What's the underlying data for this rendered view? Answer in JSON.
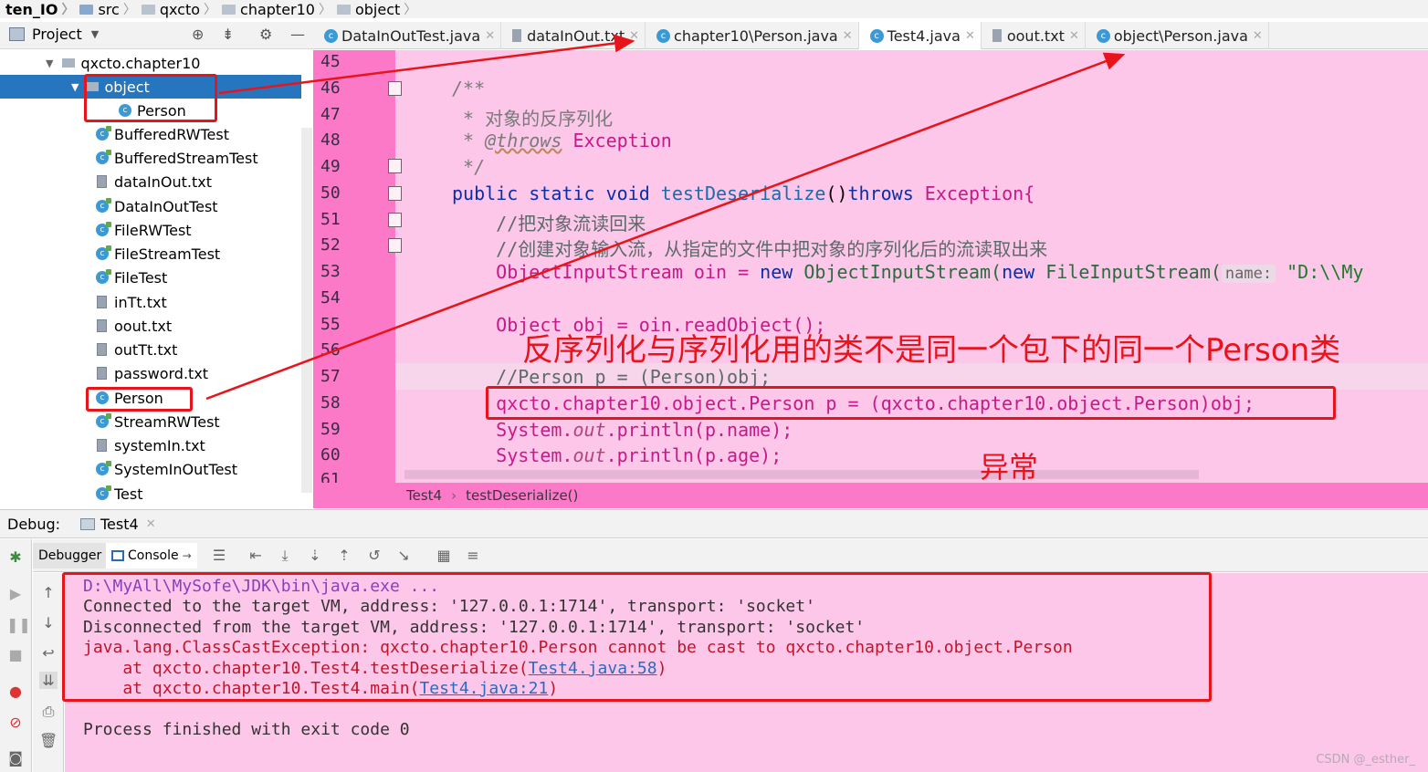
{
  "breadcrumb": [
    "ten_IO",
    "src",
    "qxcto",
    "chapter10",
    "object"
  ],
  "project_panel": {
    "title": "Project"
  },
  "tree": {
    "root": "qxcto.chapter10",
    "items": [
      {
        "label": "object",
        "kind": "package"
      },
      {
        "label": "Person",
        "kind": "class"
      },
      {
        "label": "BufferedRWTest",
        "kind": "runclass"
      },
      {
        "label": "BufferedStreamTest",
        "kind": "runclass"
      },
      {
        "label": "dataInOut.txt",
        "kind": "file"
      },
      {
        "label": "DataInOutTest",
        "kind": "runclass"
      },
      {
        "label": "FileRWTest",
        "kind": "runclass"
      },
      {
        "label": "FileStreamTest",
        "kind": "runclass"
      },
      {
        "label": "FileTest",
        "kind": "runclass"
      },
      {
        "label": "inTt.txt",
        "kind": "file"
      },
      {
        "label": "oout.txt",
        "kind": "file"
      },
      {
        "label": "outTt.txt",
        "kind": "file"
      },
      {
        "label": "password.txt",
        "kind": "file"
      },
      {
        "label": "Person",
        "kind": "class"
      },
      {
        "label": "StreamRWTest",
        "kind": "runclass"
      },
      {
        "label": "systemIn.txt",
        "kind": "file"
      },
      {
        "label": "SystemInOutTest",
        "kind": "runclass"
      },
      {
        "label": "Test",
        "kind": "runclass"
      }
    ]
  },
  "tabs": [
    {
      "label": "DataInOutTest.java",
      "icon": "class"
    },
    {
      "label": "dataInOut.txt",
      "icon": "file"
    },
    {
      "label": "chapter10\\Person.java",
      "icon": "class"
    },
    {
      "label": "Test4.java",
      "icon": "class",
      "active": true
    },
    {
      "label": "oout.txt",
      "icon": "file"
    },
    {
      "label": "object\\Person.java",
      "icon": "class"
    }
  ],
  "editor": {
    "line_numbers": [
      "45",
      "46",
      "47",
      "48",
      "49",
      "50",
      "51",
      "52",
      "53",
      "54",
      "55",
      "56",
      "57",
      "58",
      "59",
      "60",
      "61"
    ],
    "lines": {
      "l46": "/**",
      "l47a": " * ",
      "l47b": "对象的反序列化",
      "l48a": " * ",
      "l48b": "@throws",
      "l48c": " Exception",
      "l49": " */",
      "l50a": "public static void ",
      "l50b": "testDeserialize",
      "l50c": "()",
      "l50d": "throws ",
      "l50e": "Exception{",
      "l51": "    //把对象流读回来",
      "l52": "    //创建对象输入流，从指定的文件中把对象的序列化后的流读取出来",
      "l53a": "    ObjectInputStream oin = ",
      "l53b": "new ",
      "l53c": "ObjectInputStream(",
      "l53d": "new ",
      "l53e": "FileInputStream(",
      "l53hint": "name:",
      "l53f": " \"D:\\\\My",
      "l55": "    Object obj = oin.readObject();",
      "l57": "    //Person p = (Person)obj;",
      "l58": "    qxcto.chapter10.object.Person p = (qxcto.chapter10.object.Person)obj;",
      "l59a": "    System.",
      "l59b": "out",
      "l59c": ".println(p.name);",
      "l60a": "    System.",
      "l60b": "out",
      "l60c": ".println(p.age);"
    },
    "breadcrumb": [
      "Test4",
      "testDeserialize()"
    ]
  },
  "annotations": {
    "main": "反序列化与序列化用的类不是同一个包下的同一个Person类",
    "exception": "异常"
  },
  "debug": {
    "label": "Debug:",
    "tab": "Test4",
    "subtabs": [
      "Debugger",
      "Console"
    ]
  },
  "console": {
    "l1": "D:\\MyAll\\MySofe\\JDK\\bin\\java.exe ...",
    "l2": "Connected to the target VM, address: '127.0.0.1:1714', transport: 'socket'",
    "l3": "Disconnected from the target VM, address: '127.0.0.1:1714', transport: 'socket'",
    "l4": "java.lang.ClassCastException: qxcto.chapter10.Person cannot be cast to qxcto.chapter10.object.Person",
    "l5a": "    at qxcto.chapter10.Test4.testDeserialize(",
    "l5b": "Test4.java:58",
    "l5c": ")",
    "l6a": "    at qxcto.chapter10.Test4.main(",
    "l6b": "Test4.java:21",
    "l6c": ")",
    "l7": "Process finished with exit code 0"
  },
  "watermark": "CSDN @_esther_",
  "colors": {
    "annotation": "#e8141b",
    "selection": "#2675bf",
    "editor_bg": "#fcc7e8",
    "gutter_bg": "#fb79c7"
  }
}
